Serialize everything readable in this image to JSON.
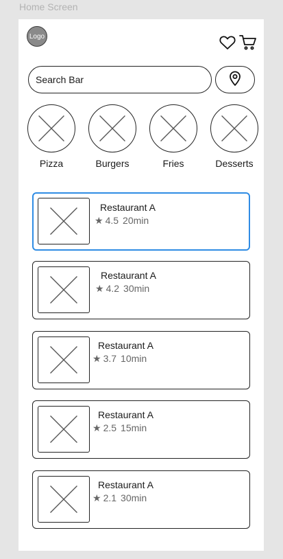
{
  "frame_label": "Home Screen",
  "header": {
    "logo_text": "Logo",
    "icons": [
      "heart-icon",
      "cart-icon"
    ]
  },
  "search": {
    "placeholder": "Search Bar",
    "location_icon": "map-pin-icon"
  },
  "categories": [
    {
      "label": "Pizza"
    },
    {
      "label": "Burgers"
    },
    {
      "label": "Fries"
    },
    {
      "label": "Desserts"
    }
  ],
  "restaurants": [
    {
      "name": "Restaurant A",
      "rating": "4.5",
      "time": "20min",
      "selected": true
    },
    {
      "name": "Restaurant A",
      "rating": "4.2",
      "time": "30min",
      "selected": false
    },
    {
      "name": "Restaurant A",
      "rating": "3.7",
      "time": "10min",
      "selected": false
    },
    {
      "name": "Restaurant A",
      "rating": "2.5",
      "time": "15min",
      "selected": false
    },
    {
      "name": "Restaurant A",
      "rating": "2.1",
      "time": "30min",
      "selected": false
    }
  ],
  "colors": {
    "selected_border": "#2f8ce4",
    "background": "#e5e5e5",
    "frame": "#ffffff"
  }
}
